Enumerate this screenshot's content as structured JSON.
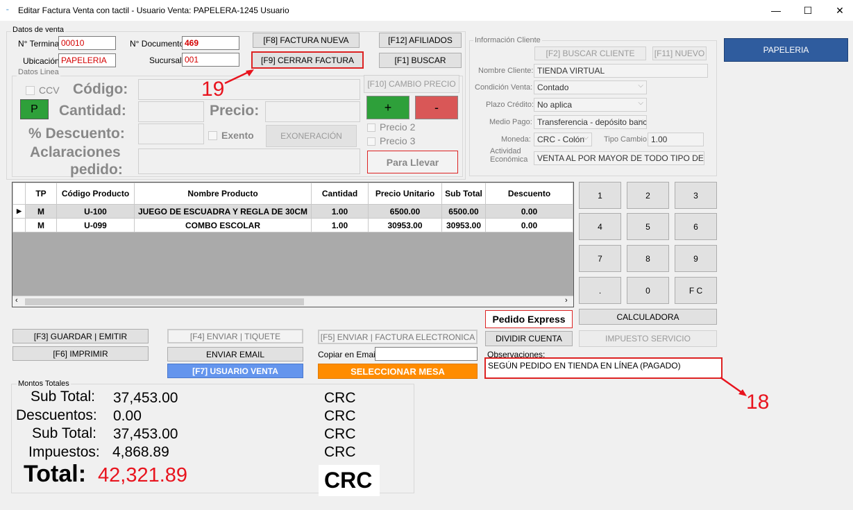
{
  "window": {
    "title": "Editar Factura Venta con tactil - Usuario Venta: PAPELERA-1245 Usuario",
    "icon": "app-icon"
  },
  "datos_venta": {
    "group_label": "Datos de venta",
    "terminal_label": "N° Terminal:",
    "terminal_value": "00010",
    "documento_label": "N° Documento:",
    "documento_value": "469",
    "ubicacion_label": "Ubicación:",
    "ubicacion_value": "PAPELERIA",
    "sucursal_label": "Sucursal:",
    "sucursal_value": "001"
  },
  "buttons": {
    "factura_nueva": "[F8] FACTURA NUEVA",
    "cerrar_factura": "[F9] CERRAR FACTURA",
    "afiliados": "[F12] AFILIADOS",
    "buscar": "[F1] BUSCAR",
    "cambio_precio": "[F10] CAMBIO PRECIO",
    "plus": "+",
    "minus": "-",
    "exoneracion": "EXONERACIÓN",
    "para_llevar": "Para Llevar",
    "papeleria": "PAPELERIA",
    "guardar_emitir": "[F3] GUARDAR | EMITIR",
    "imprimir": "[F6] IMPRIMIR",
    "enviar_tiquete": "[F4] ENVIAR | TIQUETE",
    "enviar_email": "ENVIAR EMAIL",
    "usuario_venta": "[F7] USUARIO VENTA",
    "enviar_factura": "[F5] ENVIAR | FACTURA ELECTRONICA",
    "seleccionar_mesa": "SELECCIONAR MESA",
    "pedido_express": "Pedido Express",
    "dividir_cuenta": "DIVIDIR CUENTA",
    "calculadora": "CALCULADORA",
    "impuesto_servicio": "IMPUESTO SERVICIO",
    "p": "P"
  },
  "datos_linea": {
    "group_label": "Datos Linea",
    "ccv": "CCV",
    "codigo": "Código:",
    "cantidad": "Cantidad:",
    "precio": "Precio:",
    "descuento": "% Descuento:",
    "exento": "Exento",
    "aclaraciones1": "Aclaraciones",
    "aclaraciones2": "pedido:",
    "precio2": "Precio 2",
    "precio3": "Precio 3"
  },
  "cliente": {
    "group_label": "Información Cliente",
    "buscar_cliente": "[F2] BUSCAR CLIENTE",
    "nuevo": "[F11] NUEVO",
    "nombre_label": "Nombre Cliente:",
    "nombre_value": "TIENDA  VIRTUAL",
    "condicion_label": "Condición Venta:",
    "condicion_value": "Contado",
    "plazo_label": "Plazo Crédito:",
    "plazo_value": "No aplica",
    "medio_label": "Medio Pago:",
    "medio_value": "Transferencia - depósito banc",
    "moneda_label": "Moneda:",
    "moneda_value": "CRC - Colón",
    "tipo_cambio_label": "Tipo Cambio:",
    "tipo_cambio_value": "1.00",
    "actividad_label1": "Actividad",
    "actividad_label2": "Económica",
    "actividad_value": "VENTA AL POR MAYOR DE TODO TIPO DE ."
  },
  "grid": {
    "headers": [
      "TP",
      "Código Producto",
      "Nombre Producto",
      "Cantidad",
      "Precio Unitario",
      "Sub Total",
      "Descuento"
    ],
    "rows": [
      [
        "M",
        "U-100",
        "JUEGO DE ESCUADRA Y REGLA DE 30CM",
        "1.00",
        "6500.00",
        "6500.00",
        "0.00"
      ],
      [
        "M",
        "U-099",
        "COMBO ESCOLAR",
        "1.00",
        "30953.00",
        "30953.00",
        "0.00"
      ]
    ]
  },
  "keypad": [
    "1",
    "2",
    "3",
    "4",
    "5",
    "6",
    "7",
    "8",
    "9",
    ".",
    "0",
    "F C"
  ],
  "email": {
    "copiar_label": "Copiar en Email:",
    "value": ""
  },
  "observaciones": {
    "label": "Observaciones:",
    "value": "SEGÚN PEDIDO EN TIENDA EN LÍNEA (PAGADO)"
  },
  "totales": {
    "group_label": "Montos Totales",
    "subtotal_label": "Sub Total:",
    "subtotal_value": "37,453.00",
    "descuentos_label": "Descuentos:",
    "descuentos_value": "0.00",
    "subtotal2_label": "Sub Total:",
    "subtotal2_value": "37,453.00",
    "impuestos_label": "Impuestos:",
    "impuestos_value": "4,868.89",
    "total_label": "Total:",
    "total_value": "42,321.89",
    "currency": "CRC"
  },
  "annotations": {
    "a19": "19",
    "a18": "18"
  },
  "colors": {
    "accent_red": "#e8141e",
    "plus_green": "#2ea03a",
    "minus_red": "#d95757",
    "blue_button": "#6495ed",
    "orange_button": "#ff8c00",
    "papeleria_blue": "#2f5c9e"
  }
}
